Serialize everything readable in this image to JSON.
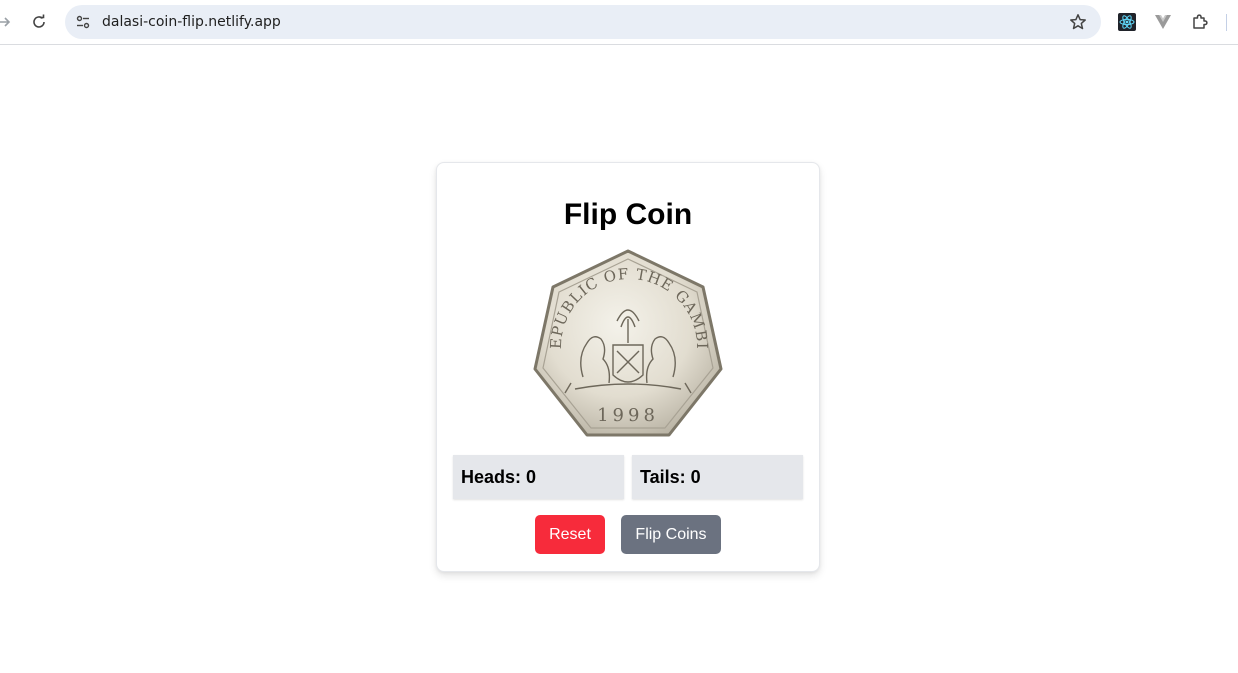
{
  "browser": {
    "url": "dalasi-coin-flip.netlify.app"
  },
  "app": {
    "title": "Flip Coin",
    "coin": {
      "inscription": "REPUBLIC OF THE GAMBIA",
      "year": "1998"
    },
    "heads_label": "Heads: 0",
    "tails_label": "Tails: 0",
    "reset_label": "Reset",
    "flip_label": "Flip Coins",
    "colors": {
      "reset": "#f72b3b",
      "flip": "#6b7280",
      "score_bg": "#e5e7eb"
    }
  }
}
